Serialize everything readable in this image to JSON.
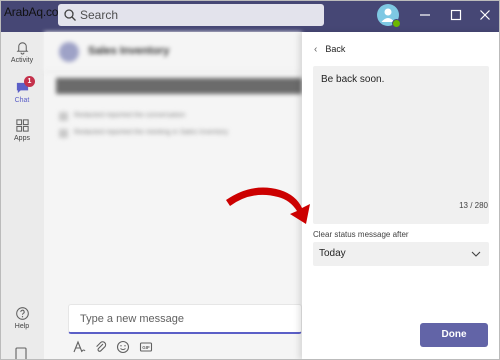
{
  "watermark": "ArabAq.com",
  "search": {
    "placeholder": "Search"
  },
  "colors": {
    "titlebar": "#464775",
    "accent": "#6264a7",
    "badge": "#c4314b",
    "annotation_arrow": "#cc0000"
  },
  "rail": {
    "items": [
      {
        "label": "Activity",
        "icon": "bell-icon"
      },
      {
        "label": "Chat",
        "icon": "chat-icon",
        "badge": "1",
        "active": true
      },
      {
        "label": "Apps",
        "icon": "apps-grid-icon"
      },
      {
        "label": "Help",
        "icon": "help-icon"
      }
    ]
  },
  "chat": {
    "title": "Sales Inventory",
    "system_lines": [
      "Redacted reported the conversation",
      "Redacted reported the meeting in Sales Inventory"
    ],
    "compose_placeholder": "Type a new message"
  },
  "panel": {
    "back_label": "Back",
    "message": "Be back soon.",
    "counter": "13 / 280",
    "clear_label": "Clear status message after",
    "clear_value": "Today",
    "done_label": "Done"
  }
}
